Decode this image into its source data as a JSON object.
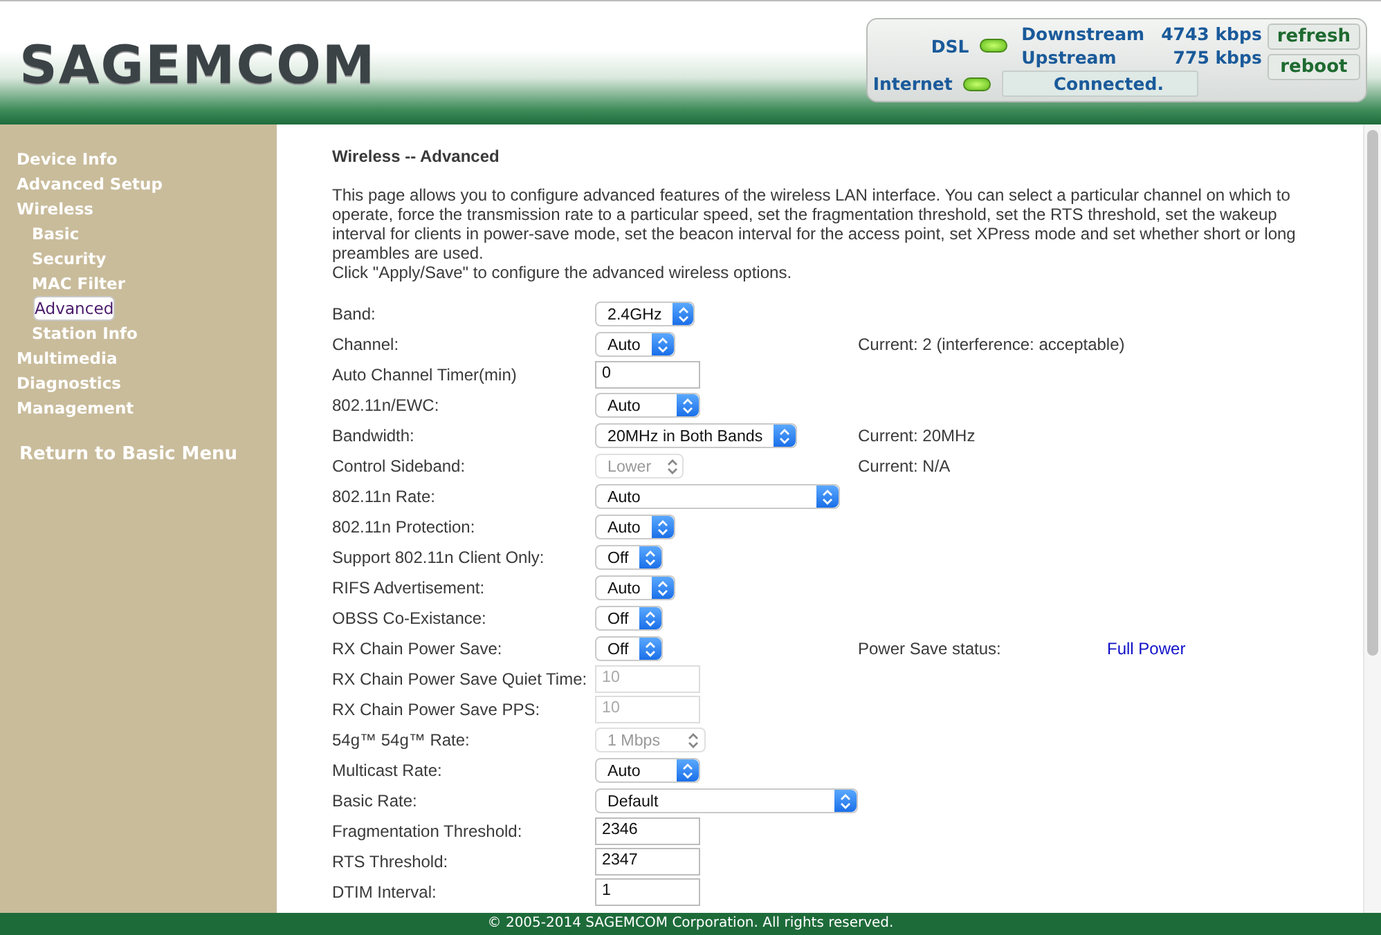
{
  "header": {
    "logo": "SAGEMCOM",
    "status": {
      "dsl": {
        "label": "DSL",
        "on": true
      },
      "internet": {
        "label": "Internet",
        "on": true
      },
      "downstream": {
        "label": "Downstream",
        "value": "4743 kbps"
      },
      "upstream": {
        "label": "Upstream",
        "value": "775 kbps"
      },
      "connection": "Connected.",
      "buttons": [
        "refresh",
        "reboot"
      ]
    }
  },
  "sidebar": {
    "items": [
      {
        "label": "Device Info",
        "selected": false
      },
      {
        "label": "Advanced Setup",
        "selected": false
      },
      {
        "label": "Wireless",
        "selected": false,
        "children": [
          {
            "label": "Basic",
            "selected": false
          },
          {
            "label": "Security",
            "selected": false
          },
          {
            "label": "MAC Filter",
            "selected": false
          },
          {
            "label": "Advanced",
            "selected": true
          },
          {
            "label": "Station Info",
            "selected": false
          }
        ]
      },
      {
        "label": "Multimedia",
        "selected": false
      },
      {
        "label": "Diagnostics",
        "selected": false
      },
      {
        "label": "Management",
        "selected": false
      }
    ],
    "return_link": "Return to Basic Menu"
  },
  "page": {
    "title": "Wireless -- Advanced",
    "description": "This page allows you to configure advanced features of the wireless LAN interface. You can select a particular channel on which to operate, force the transmission rate to a particular speed, set the fragmentation threshold, set the RTS threshold, set the wakeup interval for clients in power-save mode, set the beacon interval for the access point, set XPress mode and set whether short or long preambles are used.",
    "instruction": "Click \"Apply/Save\" to configure the advanced wireless options.",
    "fields": [
      {
        "label": "Band:",
        "kind": "select",
        "value": "2.4GHz",
        "disabled": false
      },
      {
        "label": "Channel:",
        "kind": "select",
        "value": "Auto",
        "disabled": false,
        "info": "Current: 2 (interference: acceptable)"
      },
      {
        "label": "Auto Channel Timer(min)",
        "kind": "text",
        "value": "0",
        "disabled": false
      },
      {
        "label": "802.11n/EWC:",
        "kind": "select",
        "value": "Auto",
        "disabled": false
      },
      {
        "label": "Bandwidth:",
        "kind": "select",
        "value": "20MHz in Both Bands",
        "disabled": false,
        "info": "Current: 20MHz"
      },
      {
        "label": "Control Sideband:",
        "kind": "select",
        "value": "Lower",
        "disabled": true,
        "info": "Current: N/A"
      },
      {
        "label": "802.11n Rate:",
        "kind": "select",
        "value": "Auto",
        "disabled": false
      },
      {
        "label": "802.11n Protection:",
        "kind": "select",
        "value": "Auto",
        "disabled": false
      },
      {
        "label": "Support 802.11n Client Only:",
        "kind": "select",
        "value": "Off",
        "disabled": false
      },
      {
        "label": "RIFS Advertisement:",
        "kind": "select",
        "value": "Auto",
        "disabled": false
      },
      {
        "label": "OBSS Co-Existance:",
        "kind": "select",
        "value": "Off",
        "disabled": false
      },
      {
        "label": "RX Chain Power Save:",
        "kind": "select",
        "value": "Off",
        "disabled": false,
        "info": "Power Save status:",
        "info_value": "Full Power"
      },
      {
        "label": "RX Chain Power Save Quiet Time:",
        "kind": "text",
        "value": "10",
        "disabled": true
      },
      {
        "label": "RX Chain Power Save PPS:",
        "kind": "text",
        "value": "10",
        "disabled": true
      },
      {
        "label": "54g™ 54g™ Rate:",
        "kind": "select",
        "value": "1 Mbps",
        "disabled": true
      },
      {
        "label": "Multicast Rate:",
        "kind": "select",
        "value": "Auto",
        "disabled": false
      },
      {
        "label": "Basic Rate:",
        "kind": "select",
        "value": "Default",
        "disabled": false
      },
      {
        "label": "Fragmentation Threshold:",
        "kind": "text",
        "value": "2346",
        "disabled": false
      },
      {
        "label": "RTS Threshold:",
        "kind": "text",
        "value": "2347",
        "disabled": false
      },
      {
        "label": "DTIM Interval:",
        "kind": "text",
        "value": "1",
        "disabled": false
      }
    ]
  },
  "footer": "© 2005-2014 SAGEMCOM Corporation. All rights reserved."
}
